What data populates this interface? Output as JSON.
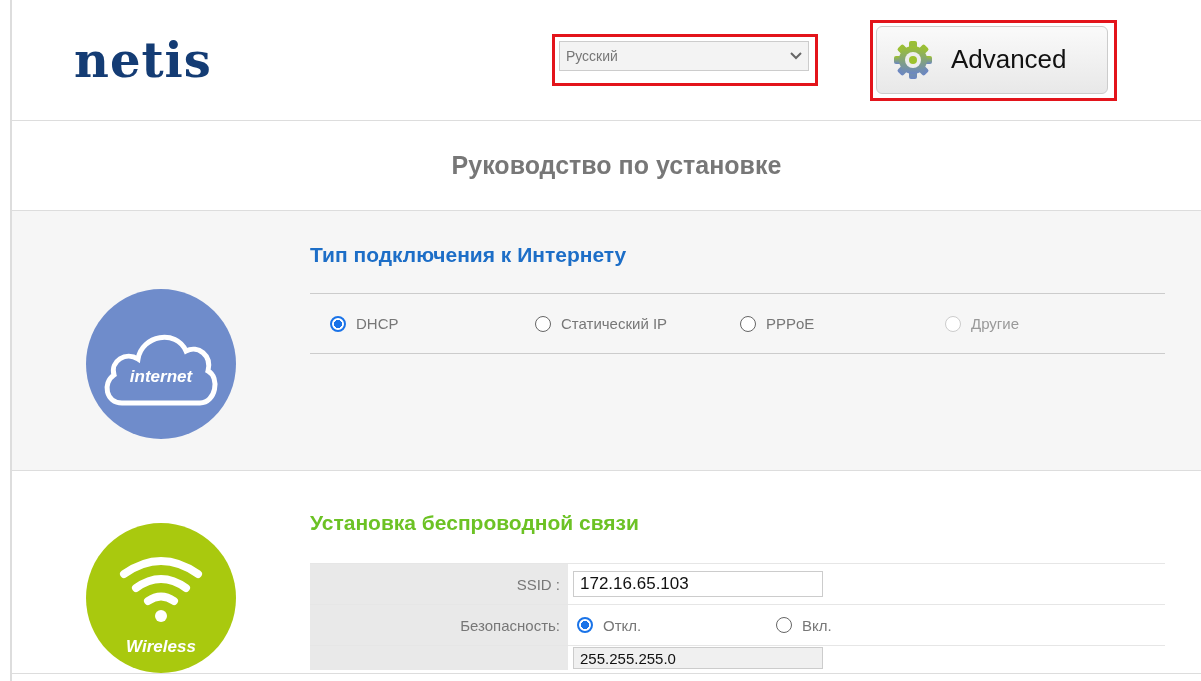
{
  "header": {
    "logo": "netis",
    "language": {
      "value": "Русский",
      "highlighted": true
    },
    "advanced_button": {
      "label": "Advanced",
      "highlighted": true
    }
  },
  "page_title": "Руководство по установке",
  "internet": {
    "icon_label": "internet",
    "title": "Тип подключения к Интернету",
    "options": [
      {
        "label": "DHCP",
        "selected": true,
        "disabled": false
      },
      {
        "label": "Статический IP",
        "selected": false,
        "disabled": false
      },
      {
        "label": "PPPoE",
        "selected": false,
        "disabled": false
      },
      {
        "label": "Другие",
        "selected": false,
        "disabled": true
      }
    ]
  },
  "wireless": {
    "icon_label": "Wireless",
    "title": "Установка беспроводной связи",
    "rows": [
      {
        "kind": "input",
        "label": "SSID :",
        "value": "172.16.65.103"
      },
      {
        "kind": "radio",
        "label": "Безопасность:",
        "options": [
          {
            "label": "Откл.",
            "selected": true
          },
          {
            "label": "Вкл.",
            "selected": false
          }
        ]
      },
      {
        "kind": "input",
        "value": "255.255.255.0"
      }
    ]
  }
}
